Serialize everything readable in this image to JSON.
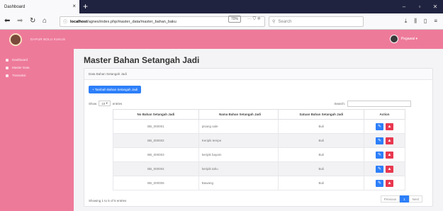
{
  "browser": {
    "tab_title": "Dashboard",
    "tab_close": "×",
    "new_tab": "+",
    "win_min": "–",
    "win_max": "▫",
    "win_close": "✕",
    "url_host": "localhost",
    "url_path": "/agnes/index.php/master_data/master_bahan_baku",
    "zoom": "70%",
    "page_actions": "··· ⛉ ☆",
    "search_placeholder": "Search"
  },
  "sidebar": {
    "brand_text": "DAPUR BOLU KUKUS",
    "items": [
      {
        "label": "Dashboard"
      },
      {
        "label": "Master Data"
      },
      {
        "label": "Transaksi"
      }
    ]
  },
  "topbar": {
    "user_name": "Pegawai ▾"
  },
  "main": {
    "page_title": "Master Bahan Setangah Jadi",
    "card_header": "Data Bahan Setangah Jadi",
    "add_button": "+ Tambah Bahan Setangah Jadi",
    "show_label": "Show",
    "show_value": "10",
    "entries_label": "entries",
    "search_label": "Search:",
    "columns": [
      "No Bahan Setangah Jadi",
      "Nama Bahan Setangah Jadi",
      "Satuan Bahan Setangah Jadi",
      "Action"
    ],
    "rows": [
      {
        "no": "BB_000001",
        "nama": "pisang sale",
        "satuan": "Buli"
      },
      {
        "no": "BB_000002",
        "nama": "Keripik tempe",
        "satuan": "Buli"
      },
      {
        "no": "BB_000003",
        "nama": "keripik bayam",
        "satuan": "Buli"
      },
      {
        "no": "BB_000004",
        "nama": "keripik tahu",
        "satuan": "Buli"
      },
      {
        "no": "BB_000005",
        "nama": "Bawang",
        "satuan": "Buli"
      }
    ],
    "edit_glyph": "✎",
    "delete_glyph": "▲",
    "showing_text": "Showing 1 to 5 of 5 entries",
    "pager": {
      "previous": "Previous",
      "page": "1",
      "next": "Next"
    }
  },
  "colors": {
    "brand_pink": "#ee7a9a",
    "primary_blue": "#2d7ff9",
    "danger_red": "#e8384f"
  }
}
